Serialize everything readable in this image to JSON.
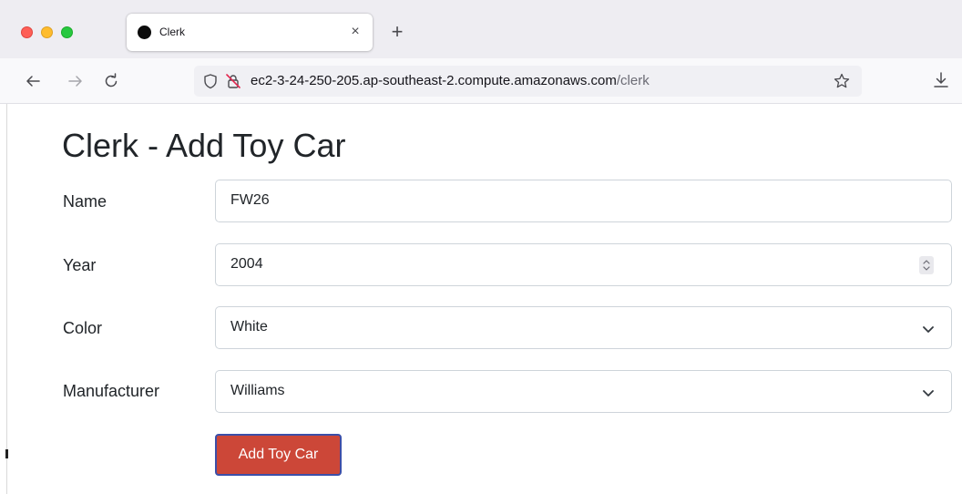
{
  "browser": {
    "tab": {
      "title": "Clerk",
      "close_glyph": "×"
    },
    "new_tab_glyph": "+",
    "url": {
      "host": "ec2-3-24-250-205.ap-southeast-2.compute.amazonaws.com",
      "path": "/clerk"
    },
    "icons": {
      "back": "arrow-left-icon",
      "forward": "arrow-right-icon",
      "reload": "reload-icon",
      "shield": "tracking-shield-icon",
      "insecure": "insecure-lock-icon",
      "bookmark": "star-icon",
      "downloads": "download-icon"
    }
  },
  "page": {
    "title": "Clerk - Add Toy Car",
    "form": {
      "name": {
        "label": "Name",
        "value": "FW26"
      },
      "year": {
        "label": "Year",
        "value": "2004"
      },
      "color": {
        "label": "Color",
        "selected": "White"
      },
      "manufacturer": {
        "label": "Manufacturer",
        "selected": "Williams"
      },
      "submit_label": "Add Toy Car"
    }
  },
  "colors": {
    "submit_bg": "#cc4738",
    "submit_border": "#3c4fa8",
    "traffic_red": "#fe5f57",
    "traffic_yellow": "#febc2e",
    "traffic_green": "#28c840"
  }
}
